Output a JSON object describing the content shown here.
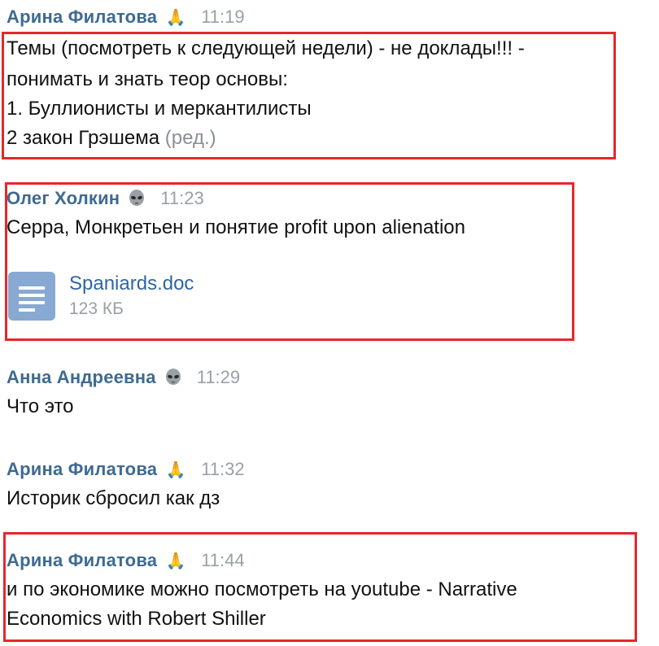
{
  "messages": [
    {
      "author": "Арина Филатова",
      "emoji": "🙏",
      "time": "11:19",
      "lines": [
        "Темы (посмотреть к следующей недели) - не доклады!!! -",
        "понимать и знать теор основы:",
        "1. Буллионисты и меркантилисты",
        "2 закон Грэшема"
      ],
      "edited_label": "(ред.)"
    },
    {
      "author": "Олег Холкин",
      "emoji_icon": "alien-icon",
      "time": "11:23",
      "lines": [
        "Серра, Монкретьен и понятие profit upon alienation"
      ],
      "attachment": {
        "icon": "document-file-icon",
        "name": "Spaniards.doc",
        "size": "123 КБ"
      }
    },
    {
      "author": "Анна Андреевна",
      "emoji_icon": "alien-icon",
      "time": "11:29",
      "lines": [
        "Что это"
      ]
    },
    {
      "author": "Арина Филатова",
      "emoji": "🙏",
      "time": "11:32",
      "lines": [
        "Историк сбросил как дз"
      ]
    },
    {
      "author": "Арина Филатова",
      "emoji": "🙏",
      "time": "11:44",
      "lines": [
        "и по экономике можно посмотреть на youtube - Narrative",
        "Economics with Robert Shiller"
      ]
    }
  ],
  "colors": {
    "author": "#3e6a92",
    "time": "#9aa0a6",
    "highlight_border": "#e8262a",
    "file_icon": "#87a9d3",
    "file_name": "#2f66a3"
  }
}
